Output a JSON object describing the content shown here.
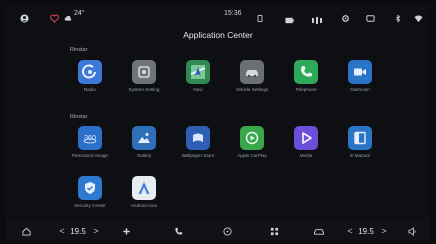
{
  "status_bar": {
    "temperature": "24°",
    "time": "15:36"
  },
  "page_title": "Application Center",
  "sections": {
    "section_1_label": "Rinstar",
    "section_2_label": "Rinstar"
  },
  "apps": {
    "row1": [
      {
        "label": "Radio",
        "icon": "radio-icon",
        "color": "#3d78d6"
      },
      {
        "label": "System Setting",
        "icon": "gear-icon",
        "color": "#6f7276"
      },
      {
        "label": "Navi",
        "icon": "map-icon",
        "color": "#2f8a52"
      },
      {
        "label": "Vehicle Settings",
        "icon": "car-icon",
        "color": "#6c7075"
      },
      {
        "label": "Telephone",
        "icon": "phone-icon",
        "color": "#2ea85a"
      },
      {
        "label": "Dashcam",
        "icon": "camera-icon",
        "color": "#2a73c9"
      }
    ],
    "row2": [
      {
        "label": "Panoramic Image",
        "icon": "360-icon",
        "color": "#2a6fc8"
      },
      {
        "label": "Gallery",
        "icon": "gallery-icon",
        "color": "#2e6fb8"
      },
      {
        "label": "Wallpaper Store",
        "icon": "wallpaper-icon",
        "color": "#2f5fb5"
      },
      {
        "label": "Apple CarPlay",
        "icon": "carplay-icon",
        "color": "#3aa84a"
      },
      {
        "label": "Media",
        "icon": "play-icon",
        "color": "#6b4fd8"
      },
      {
        "label": "E-Manual",
        "icon": "book-icon",
        "color": "#2c74c6"
      }
    ],
    "row3": [
      {
        "label": "Security Center",
        "icon": "shield-icon",
        "color": "#2f7ad0"
      },
      {
        "label": "Android Auto",
        "icon": "android-auto-icon",
        "color": "#e9ecef"
      }
    ]
  },
  "dock": {
    "left_temperature": "19.5",
    "right_temperature": "19.5",
    "left_arrow_prev": "<",
    "left_arrow_next": ">",
    "right_arrow_prev": "<",
    "right_arrow_next": ">"
  }
}
